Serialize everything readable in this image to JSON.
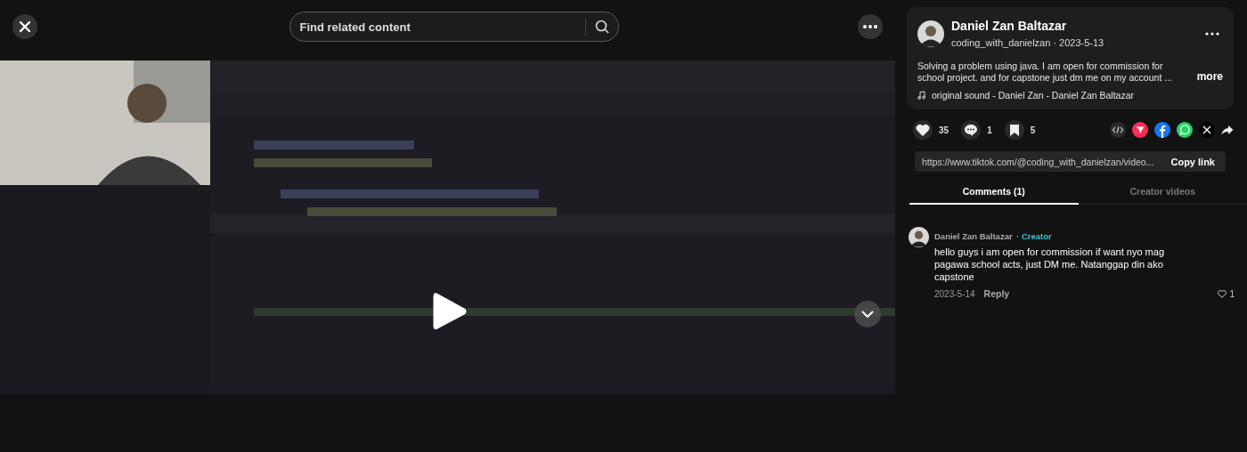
{
  "search": {
    "placeholder": "Find related content"
  },
  "video": {
    "kind": "picture",
    "paused": true
  },
  "author": {
    "name": "Daniel Zan Baltazar",
    "byline": "coding_with_danielzan · 2023-5-13"
  },
  "caption": "Solving a problem using java. I am open for commission for school project. and for capstone just dm me on my account ...",
  "more": "more",
  "sound": "original sound - Daniel Zan - Daniel Zan Baltazar",
  "stats": [
    {
      "kind": "like",
      "count": "35"
    },
    {
      "kind": "comment",
      "count": "1"
    },
    {
      "kind": "save",
      "count": "5"
    }
  ],
  "link": {
    "url": "https://www.tiktok.com/@coding_with_danielzan/video...",
    "button": "Copy link"
  },
  "tabs": [
    {
      "label": "Comments (1)",
      "selected": true
    },
    {
      "label": "Creator videos",
      "selected": false
    }
  ],
  "comments": [
    {
      "author": "Daniel Zan Baltazar",
      "badge": "· Creator",
      "text": "hello guys i am open for commission if want nyo mag pagawa school acts, just DM me. Natanggap din ako capstone",
      "date": "2023-5-14",
      "reply": "Reply",
      "likes": "1"
    }
  ]
}
